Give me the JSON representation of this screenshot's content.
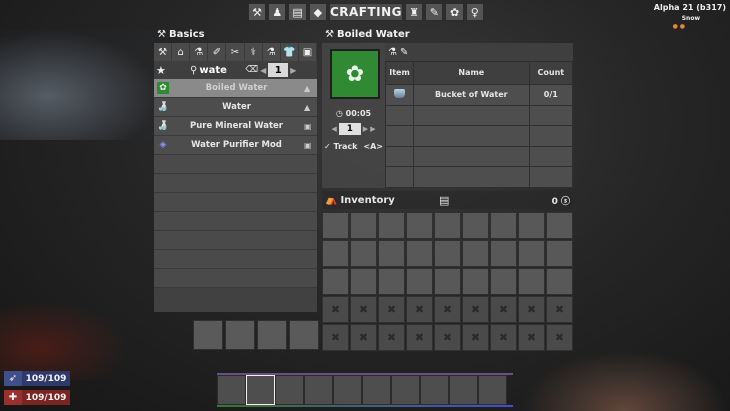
{
  "hud": {
    "build": "Alpha 21 (b317)",
    "weather": "Snow",
    "weather_icons": "● ●"
  },
  "topbar": {
    "title": "CRAFTING",
    "icons_left": [
      "⚒",
      "♟",
      "▤",
      "◆"
    ],
    "icons_right": [
      "♜",
      "✎",
      "✿",
      "♀"
    ]
  },
  "categories": {
    "title": "Basics",
    "title_icon": "⚒",
    "filters": [
      "⚒",
      "⌂",
      "⚗",
      "✐",
      "✂",
      "⚕",
      "⚗",
      "👕",
      "▣"
    ],
    "search": {
      "value": "wate",
      "page": "1"
    },
    "recipes": [
      {
        "name": "Boiled Water",
        "icon": "✿",
        "selected": true
      },
      {
        "name": "Water",
        "icon": "🍶",
        "selected": false
      },
      {
        "name": "Pure Mineral Water",
        "icon": "🍶",
        "selected": false
      },
      {
        "name": "Water Purifier Mod",
        "icon": "◈",
        "selected": false
      }
    ]
  },
  "detail": {
    "title": "Boiled Water",
    "title_icon": "⚒",
    "time": "00:05",
    "craft_count": "1",
    "track_label": "Track",
    "track_key": "<A>",
    "columns": {
      "item": "Item",
      "name": "Name",
      "count": "Count"
    },
    "ingredients": [
      {
        "name": "Bucket of Water",
        "count": "0/1"
      }
    ]
  },
  "inventory": {
    "title": "Inventory",
    "money": "0",
    "unlocked_slots": 27,
    "locked_slots": 18
  },
  "vitals": {
    "stamina": "109/109",
    "health": "109/109"
  },
  "hotbar": {
    "slots": 10,
    "selected": 1
  }
}
